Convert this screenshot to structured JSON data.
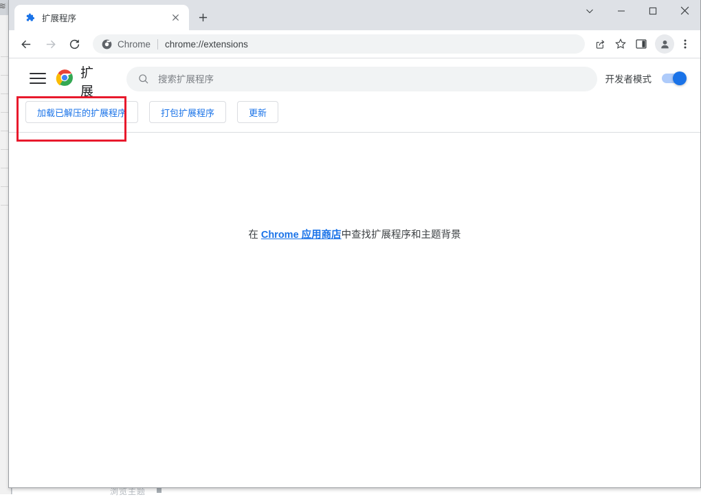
{
  "window": {
    "controls": [
      {
        "name": "tab-search",
        "glyph": "chevron-down"
      },
      {
        "name": "minimize",
        "glyph": "minus"
      },
      {
        "name": "maximize",
        "glyph": "square"
      },
      {
        "name": "close",
        "glyph": "cross"
      }
    ]
  },
  "tabstrip": {
    "tab": {
      "title": "扩展程序",
      "favicon": "puzzle-piece-icon",
      "close_label": "×"
    },
    "new_tab_label": "+"
  },
  "toolbar": {
    "back": "←",
    "forward": "→",
    "reload": "⟳",
    "omnibox": {
      "chip_icon": "chrome-icon",
      "scheme_label": "Chrome",
      "url": "chrome://extensions"
    },
    "icons": [
      {
        "name": "share-icon"
      },
      {
        "name": "bookmark-star-icon"
      },
      {
        "name": "side-panel-icon"
      },
      {
        "name": "profile-avatar"
      },
      {
        "name": "more-menu-icon"
      }
    ]
  },
  "extensions_page": {
    "menu_icon": "hamburger-menu-icon",
    "brand_icon": "chrome-logo-icon",
    "title": "扩展程序",
    "search": {
      "placeholder": "搜索扩展程序",
      "value": "",
      "icon": "search-icon"
    },
    "developer_mode": {
      "label": "开发者模式",
      "enabled": true
    },
    "actions": [
      {
        "name": "load-unpacked",
        "label": "加载已解压的扩展程序"
      },
      {
        "name": "pack-extension",
        "label": "打包扩展程序"
      },
      {
        "name": "update",
        "label": "更新"
      }
    ],
    "empty_state": {
      "prefix": "在 ",
      "link_text": "Chrome 应用商店",
      "suffix": "中查找扩展程序和主题背景"
    }
  },
  "background": {
    "bottom_text": "浏览主题"
  },
  "colors": {
    "accent_blue": "#1a73e8",
    "toggle_track": "#aecbfa",
    "tabstrip_bg": "#dee1e6",
    "field_bg": "#f1f3f4",
    "annotation_red": "#e8192c",
    "border_gray": "#dadce0"
  }
}
